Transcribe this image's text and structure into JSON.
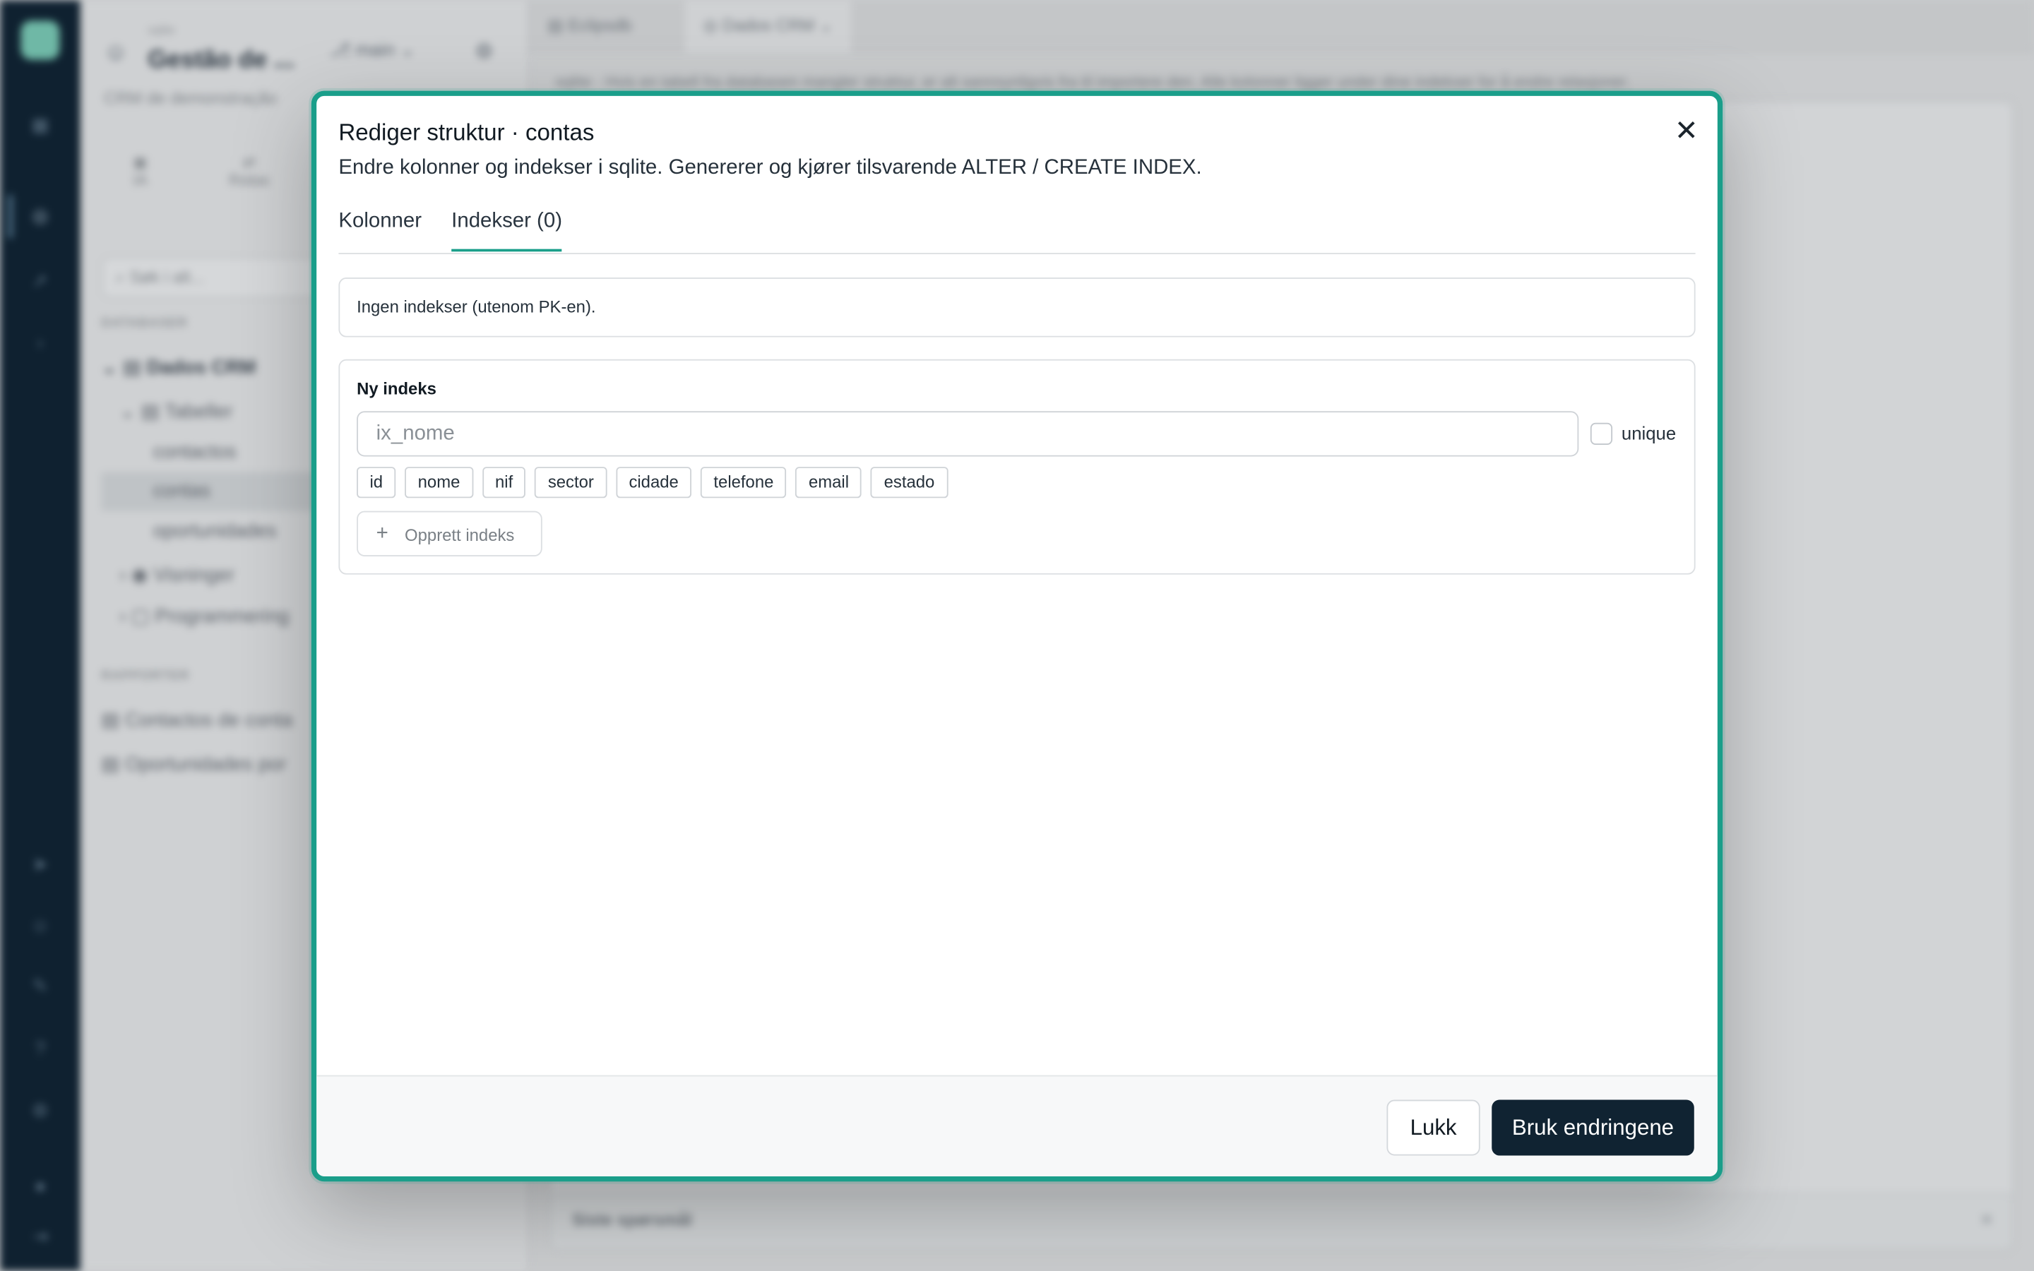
{
  "background": {
    "sidebar": {
      "kicker": "sqlite",
      "title": "Gestão de ...",
      "subtitle": "CRM de demonstração",
      "branch": "main",
      "tools": [
        "IA",
        "Rotas"
      ],
      "search_placeholder": "Søk i alt...",
      "section_databases": "DATABASER",
      "tree": {
        "db": "Dados CRM",
        "tables_group": "Tabeller",
        "tables": [
          "contactos",
          "contas",
          "oportunidades"
        ],
        "views_group": "Visninger",
        "programs_group": "Programmering"
      },
      "section_reports": "RAPPORTER",
      "reports": [
        "Contactos de conta",
        "Oportunidades por"
      ]
    },
    "tabs": [
      "Eclipsdb",
      "Dados CRM"
    ],
    "info": "sqlite · Hvis en tabell fra databasen mangler struktur, er alt sannsynligvis fra til importere den. Alle kolonner ligger under dine indekser for å endre relasjoner.",
    "footer_label": "Siste spørsmål"
  },
  "modal": {
    "title": "Rediger struktur · contas",
    "description": "Endre kolonner og indekser i sqlite. Genererer og kjører tilsvarende ALTER / CREATE INDEX.",
    "tabs": [
      {
        "label": "Kolonner",
        "active": false
      },
      {
        "label": "Indekser (0)",
        "active": true
      }
    ],
    "empty_message": "Ingen indekser (utenom PK-en).",
    "new_index": {
      "label": "Ny indeks",
      "name_placeholder": "ix_nome",
      "name_value": "",
      "unique_label": "unique",
      "unique_checked": false,
      "columns": [
        "id",
        "nome",
        "nif",
        "sector",
        "cidade",
        "telefone",
        "email",
        "estado"
      ],
      "create_label": "Opprett indeks"
    },
    "footer": {
      "close_label": "Lukk",
      "apply_label": "Bruk endringene"
    }
  },
  "colors": {
    "accent": "#1a9e8a",
    "primary_button": "#102332",
    "rail": "#0f2130"
  }
}
